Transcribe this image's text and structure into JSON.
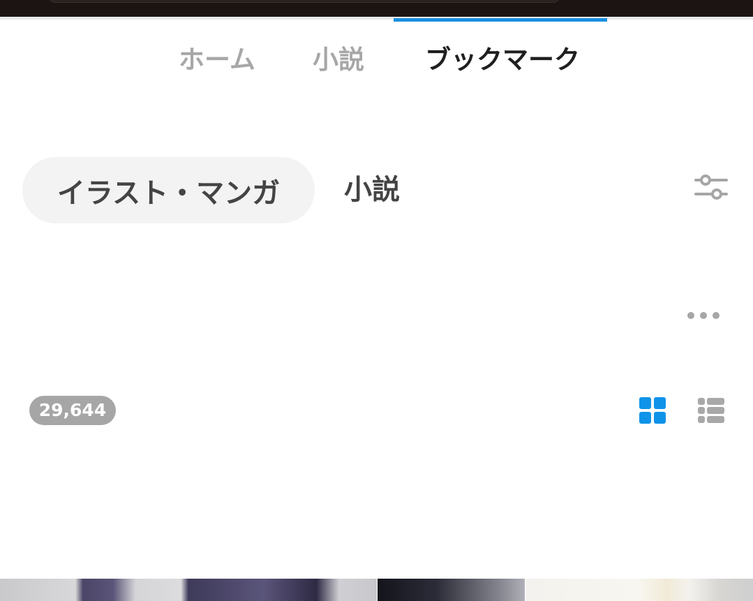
{
  "header": {
    "tabs": [
      {
        "label": "ホーム",
        "active": false
      },
      {
        "label": "小説",
        "active": false
      },
      {
        "label": "ブックマーク",
        "active": true
      }
    ],
    "active_indicator_color": "#1a8fe0"
  },
  "subtabs": {
    "items": [
      {
        "label": "イラスト・マンガ",
        "active": true
      },
      {
        "label": "小説",
        "active": false
      }
    ],
    "filter_icon": "sliders-icon"
  },
  "toolbar": {
    "more_icon": "more-horizontal-icon",
    "count": "29,644",
    "view_modes": [
      {
        "icon": "grid-view-icon",
        "active": true,
        "color": "#0e93e9"
      },
      {
        "icon": "list-view-icon",
        "active": false,
        "color": "#a8a8a8"
      }
    ]
  },
  "thumbnails": {
    "count_visible": 3
  }
}
